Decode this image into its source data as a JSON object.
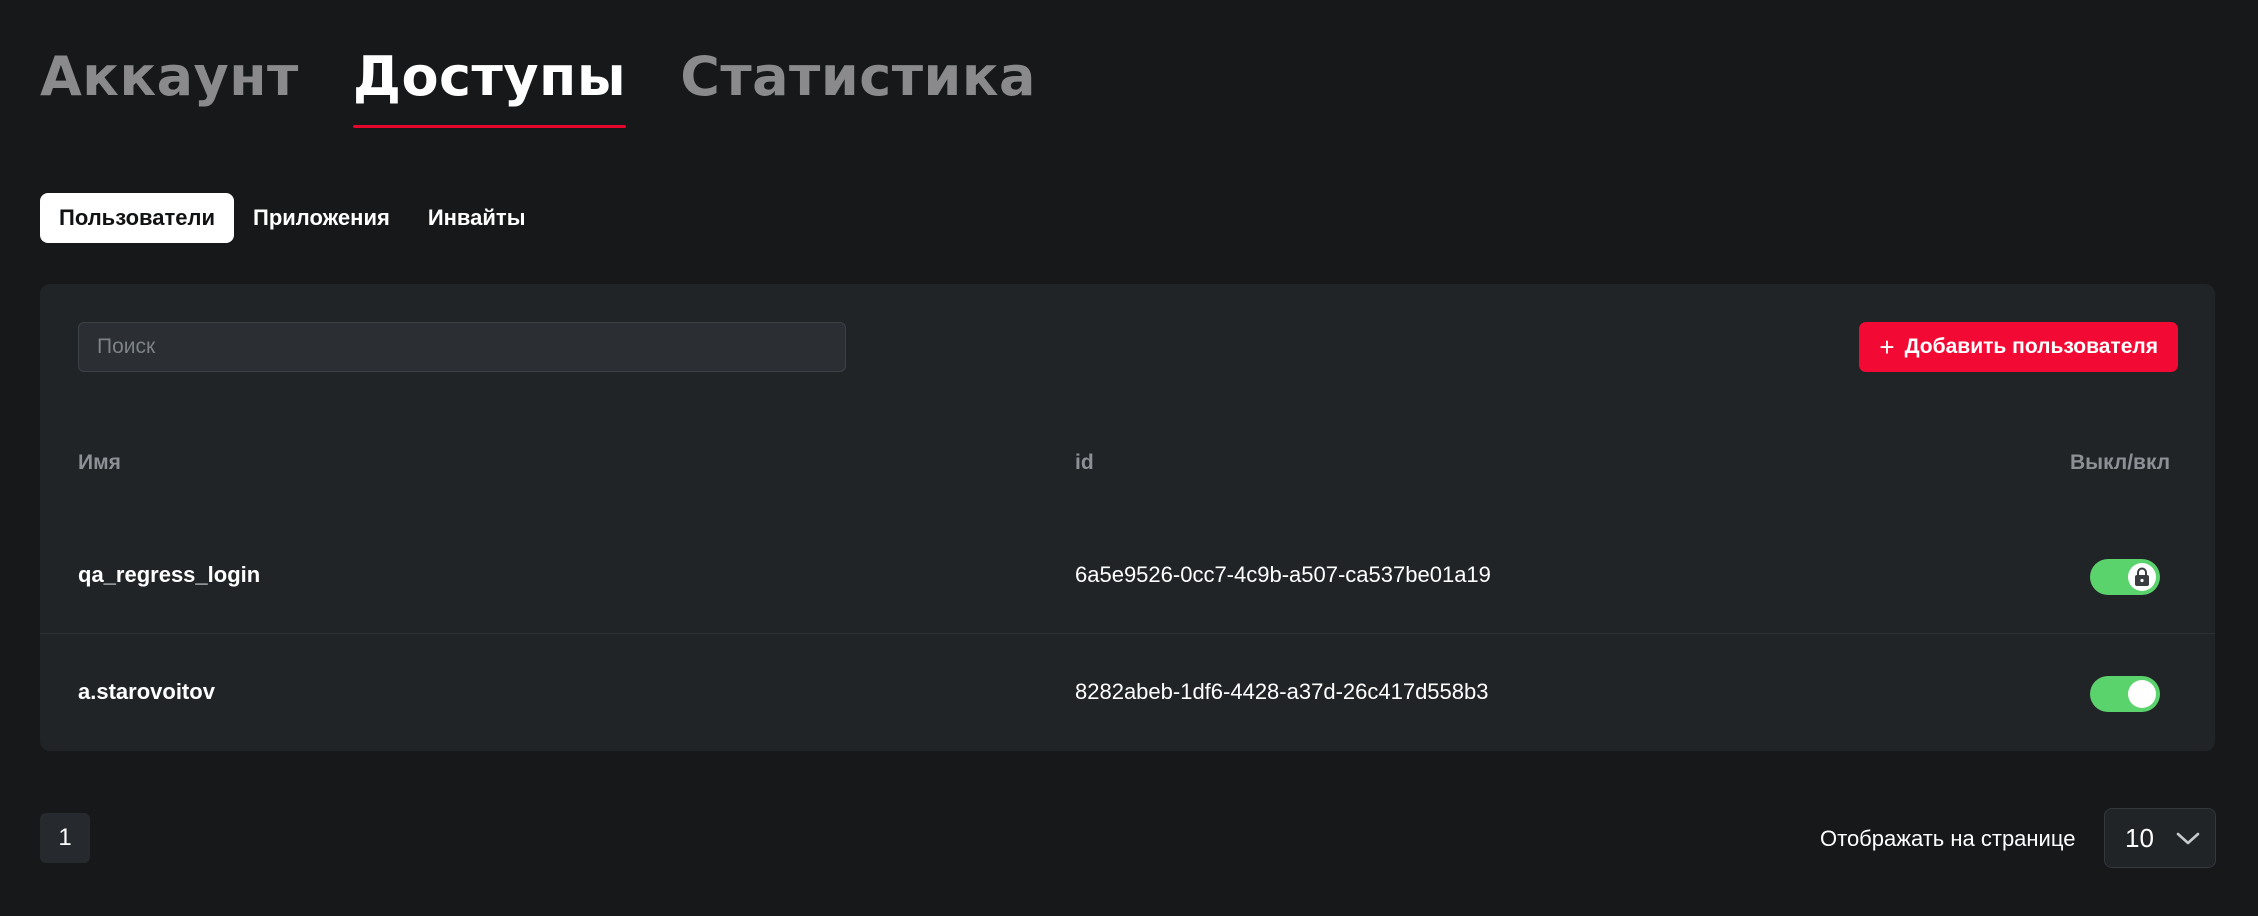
{
  "main_tabs": [
    {
      "label": "Аккаунт",
      "active": false
    },
    {
      "label": "Доступы",
      "active": true
    },
    {
      "label": "Статистика",
      "active": false
    }
  ],
  "sub_tabs": [
    {
      "label": "Пользователи",
      "active": true
    },
    {
      "label": "Приложения",
      "active": false
    },
    {
      "label": "Инвайты",
      "active": false
    }
  ],
  "search": {
    "placeholder": "Поиск",
    "value": ""
  },
  "add_button": {
    "label": "Добавить пользователя",
    "icon": "plus-icon"
  },
  "table": {
    "headers": {
      "name": "Имя",
      "id": "id",
      "toggle": "Выкл/вкл"
    },
    "rows": [
      {
        "name": "qa_regress_login",
        "id": "6a5e9526-0cc7-4c9b-a507-ca537be01a19",
        "enabled": true,
        "locked": true
      },
      {
        "name": "a.starovoitov",
        "id": "8282abeb-1df6-4428-a37d-26c417d558b3",
        "enabled": true,
        "locked": false
      }
    ]
  },
  "pagination": {
    "current_page": "1",
    "per_page_label": "Отображать на странице",
    "per_page_value": "10"
  },
  "colors": {
    "accent": "#f20a35",
    "toggle_on": "#5bd36d",
    "background": "#17181a",
    "card": "#212427"
  }
}
